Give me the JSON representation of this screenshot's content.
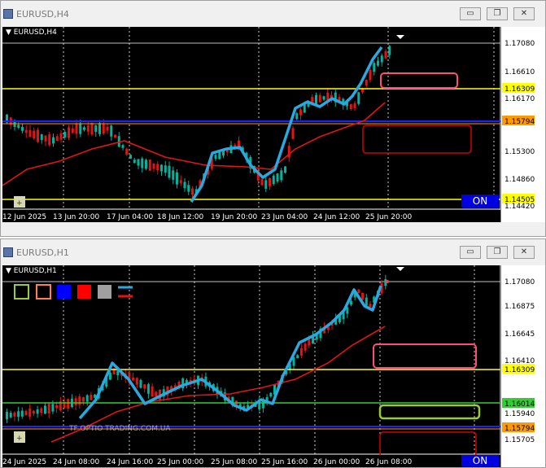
{
  "window1": {
    "title": "EURUSD,H4",
    "symbol": "EURUSD,H4",
    "on_label": "ON",
    "price_labels": [
      "1.17080",
      "1.16610",
      "1.16309",
      "1.16170",
      "1.15794",
      "1.15300",
      "1.14860",
      "1.14505",
      "1.14420"
    ],
    "time_labels": [
      "12 Jun 2025",
      "13 Jun 20:00",
      "17 Jun 04:00",
      "18 Jun 12:00",
      "19 Jun 20:00",
      "23 Jun 04:00",
      "24 Jun 12:00",
      "25 Jun 20:00"
    ]
  },
  "window2": {
    "title": "EURUSD,H1",
    "symbol": "EURUSD,H1",
    "on_label": "ON",
    "watermark": "TF OPTIO TRADING.COM.UA",
    "price_labels": [
      "1.17080",
      "1.16875",
      "1.16645",
      "1.16410",
      "1.16309",
      "1.16014",
      "1.15940",
      "1.15794",
      "1.15705"
    ],
    "time_labels": [
      "24 Jun 2025",
      "24 Jun 08:00",
      "24 Jun 16:00",
      "25 Jun 00:00",
      "25 Jun 08:00",
      "25 Jun 16:00",
      "26 Jun 00:00",
      "26 Jun 08:00"
    ]
  },
  "window_buttons": {
    "minimize": "▭",
    "restore": "❐",
    "close": "✕"
  },
  "colors": {
    "bull": "#00b4a0",
    "bear": "#e31414",
    "hma": "#29a9e0",
    "ma": "#e31414",
    "level_yellow": "#ffff00",
    "level_blue": "#2020ff",
    "level_green": "#32cd32",
    "level_orange": "#ff9900",
    "box_pink": "#ff4d7a",
    "box_red": "#d40000",
    "box_green": "#9acd32"
  },
  "palette_icons": [
    "square-outline-green",
    "square-outline-orange",
    "square-blue",
    "square-red",
    "square-gray",
    "line-style"
  ]
}
